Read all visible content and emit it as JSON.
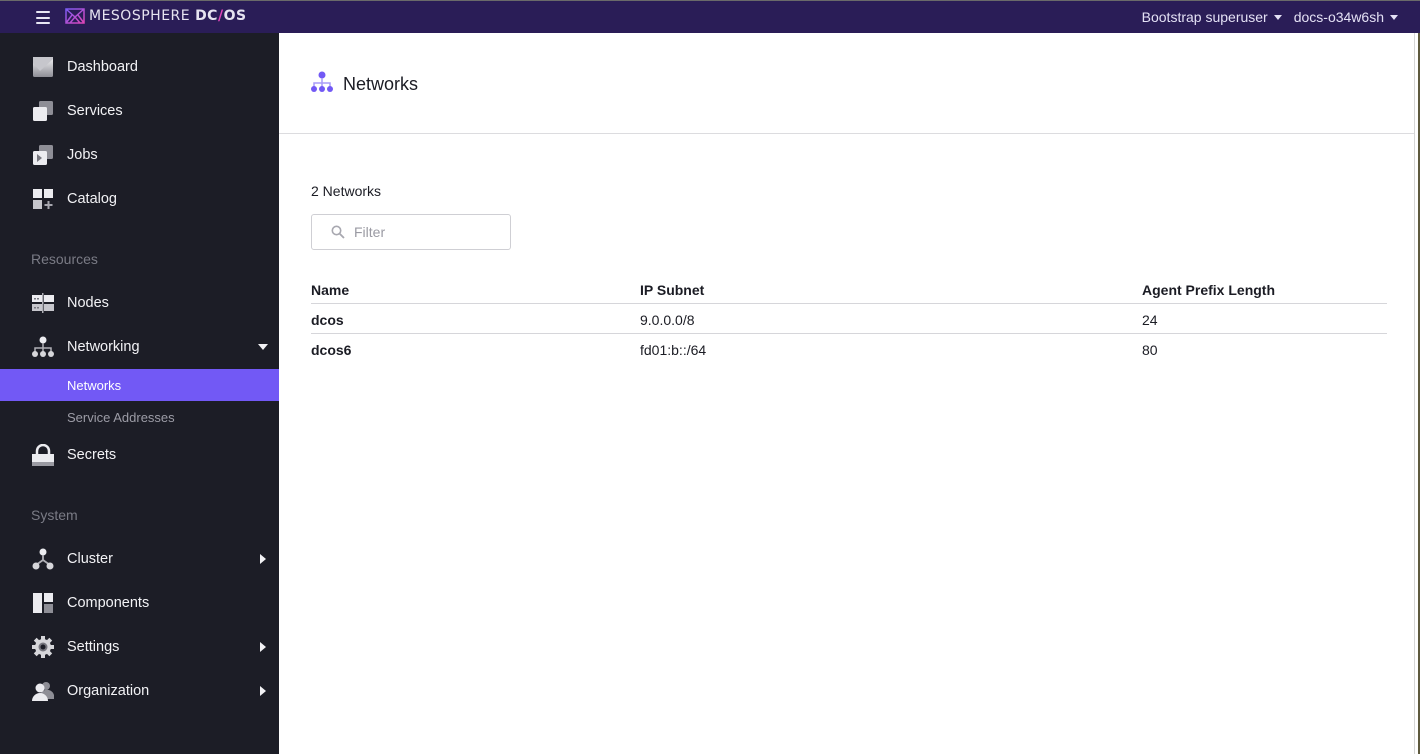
{
  "topbar": {
    "brand_light": "MESOSPHERE",
    "brand_bold_1": "DC",
    "brand_slash": "/",
    "brand_bold_2": "OS",
    "user_menu": "Bootstrap superuser",
    "cluster_menu": "docs-o34w6sh"
  },
  "sidebar": {
    "top_items": [
      {
        "label": "Dashboard",
        "icon": "dashboard-icon"
      },
      {
        "label": "Services",
        "icon": "services-icon"
      },
      {
        "label": "Jobs",
        "icon": "jobs-icon"
      },
      {
        "label": "Catalog",
        "icon": "catalog-icon"
      }
    ],
    "resources_label": "Resources",
    "resources_items": [
      {
        "label": "Nodes",
        "icon": "nodes-icon"
      },
      {
        "label": "Networking",
        "icon": "networking-icon",
        "expanded": true
      }
    ],
    "networking_sub": [
      {
        "label": "Networks",
        "active": true
      },
      {
        "label": "Service Addresses",
        "active": false
      }
    ],
    "secrets": {
      "label": "Secrets",
      "icon": "lock-icon"
    },
    "system_label": "System",
    "system_items": [
      {
        "label": "Cluster",
        "icon": "cluster-icon",
        "has_children": true
      },
      {
        "label": "Components",
        "icon": "components-icon",
        "has_children": false
      },
      {
        "label": "Settings",
        "icon": "gear-icon",
        "has_children": true
      },
      {
        "label": "Organization",
        "icon": "organization-icon",
        "has_children": true
      }
    ]
  },
  "colors": {
    "topbar": "#2a1d57",
    "sidebar": "#1c1d26",
    "accent": "#7259f5"
  },
  "page": {
    "title": "Networks",
    "count_text": "2 Networks",
    "filter_placeholder": "Filter",
    "filter_value": ""
  },
  "table": {
    "columns": [
      "Name",
      "IP Subnet",
      "Agent Prefix Length"
    ],
    "rows": [
      {
        "name": "dcos",
        "subnet": "9.0.0.0/8",
        "prefix": "24"
      },
      {
        "name": "dcos6",
        "subnet": "fd01:b::/64",
        "prefix": "80"
      }
    ]
  }
}
